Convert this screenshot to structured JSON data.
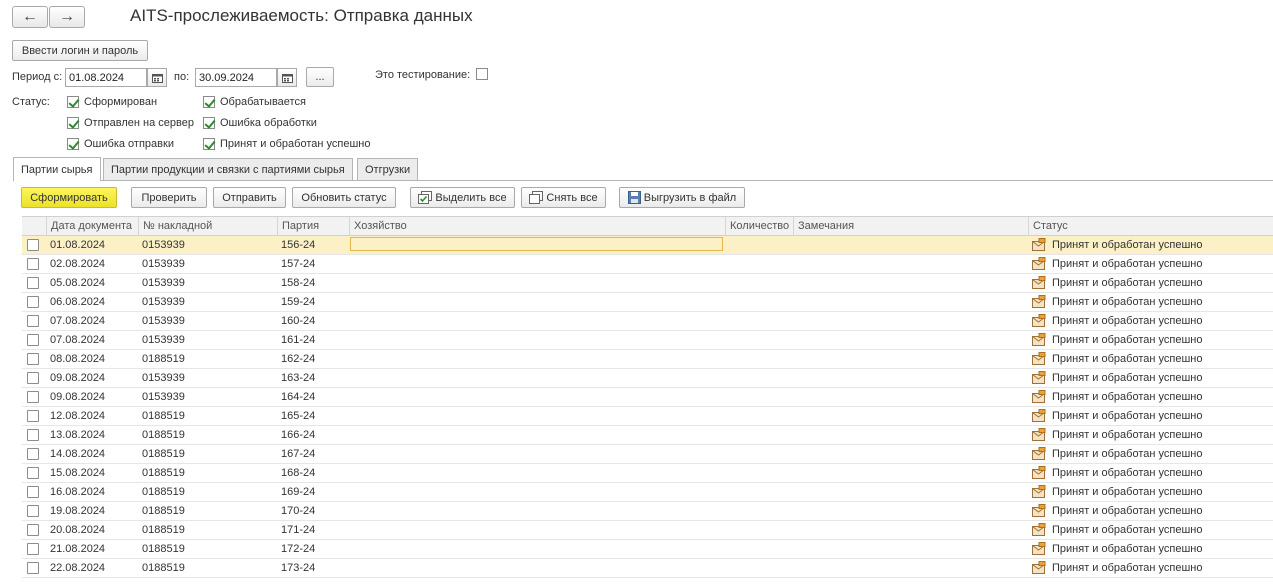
{
  "window": {
    "title": "AITS-прослеживаемость: Отправка данных"
  },
  "nav": {
    "back_glyph": "←",
    "forward_glyph": "→"
  },
  "login_button": "Ввести логин и пароль",
  "period": {
    "from_label": "Период с:",
    "from_value": "01.08.2024",
    "to_label": "по:",
    "to_value": "30.09.2024",
    "more_button": "..."
  },
  "testing": {
    "label": "Это тестирование:",
    "checked": false
  },
  "status_filter": {
    "label": "Статус:",
    "options": [
      {
        "label": "Сформирован",
        "checked": true
      },
      {
        "label": "Отправлен на сервер",
        "checked": true
      },
      {
        "label": "Ошибка отправки",
        "checked": true
      },
      {
        "label": "Обрабатывается",
        "checked": true
      },
      {
        "label": "Ошибка обработки",
        "checked": true
      },
      {
        "label": "Принят и обработан успешно",
        "checked": true
      }
    ]
  },
  "tabs": [
    {
      "label": "Партии сырья",
      "active": true
    },
    {
      "label": "Партии продукции и связки с партиями сырья",
      "active": false
    },
    {
      "label": "Отгрузки",
      "active": false
    }
  ],
  "toolbar": {
    "form": "Сформировать",
    "check": "Проверить",
    "send": "Отправить",
    "refresh": "Обновить статус",
    "select_all": "Выделить все",
    "deselect_all": "Снять все",
    "export": "Выгрузить в файл"
  },
  "table": {
    "columns": [
      "Дата документа",
      "№ накладной",
      "Партия",
      "Хозяйство",
      "Количество",
      "Замечания",
      "Статус"
    ],
    "rows": [
      {
        "date": "01.08.2024",
        "invoice": "0153939",
        "batch": "156-24",
        "status": "Принят и обработан успешно"
      },
      {
        "date": "02.08.2024",
        "invoice": "0153939",
        "batch": "157-24",
        "status": "Принят и обработан успешно"
      },
      {
        "date": "05.08.2024",
        "invoice": "0153939",
        "batch": "158-24",
        "status": "Принят и обработан успешно"
      },
      {
        "date": "06.08.2024",
        "invoice": "0153939",
        "batch": "159-24",
        "status": "Принят и обработан успешно"
      },
      {
        "date": "07.08.2024",
        "invoice": "0153939",
        "batch": "160-24",
        "status": "Принят и обработан успешно"
      },
      {
        "date": "07.08.2024",
        "invoice": "0153939",
        "batch": "161-24",
        "status": "Принят и обработан успешно"
      },
      {
        "date": "08.08.2024",
        "invoice": "0188519",
        "batch": "162-24",
        "status": "Принят и обработан успешно"
      },
      {
        "date": "09.08.2024",
        "invoice": "0153939",
        "batch": "163-24",
        "status": "Принят и обработан успешно"
      },
      {
        "date": "09.08.2024",
        "invoice": "0153939",
        "batch": "164-24",
        "status": "Принят и обработан успешно"
      },
      {
        "date": "12.08.2024",
        "invoice": "0188519",
        "batch": "165-24",
        "status": "Принят и обработан успешно"
      },
      {
        "date": "13.08.2024",
        "invoice": "0188519",
        "batch": "166-24",
        "status": "Принят и обработан успешно"
      },
      {
        "date": "14.08.2024",
        "invoice": "0188519",
        "batch": "167-24",
        "status": "Принят и обработан успешно"
      },
      {
        "date": "15.08.2024",
        "invoice": "0188519",
        "batch": "168-24",
        "status": "Принят и обработан успешно"
      },
      {
        "date": "16.08.2024",
        "invoice": "0188519",
        "batch": "169-24",
        "status": "Принят и обработан успешно"
      },
      {
        "date": "19.08.2024",
        "invoice": "0188519",
        "batch": "170-24",
        "status": "Принят и обработан успешно"
      },
      {
        "date": "20.08.2024",
        "invoice": "0188519",
        "batch": "171-24",
        "status": "Принят и обработан успешно"
      },
      {
        "date": "21.08.2024",
        "invoice": "0188519",
        "batch": "172-24",
        "status": "Принят и обработан успешно"
      },
      {
        "date": "22.08.2024",
        "invoice": "0188519",
        "batch": "173-24",
        "status": "Принят и обработан успешно"
      }
    ]
  },
  "colors": {
    "accent_button": "#f4ec3a",
    "selected_row": "#fbf0c6"
  },
  "icons": {
    "calendar": "calendar-icon",
    "select_all": "select-all-icon",
    "deselect_all": "deselect-all-icon",
    "export": "floppy-disk-icon",
    "status": "status-envelope-icon"
  }
}
